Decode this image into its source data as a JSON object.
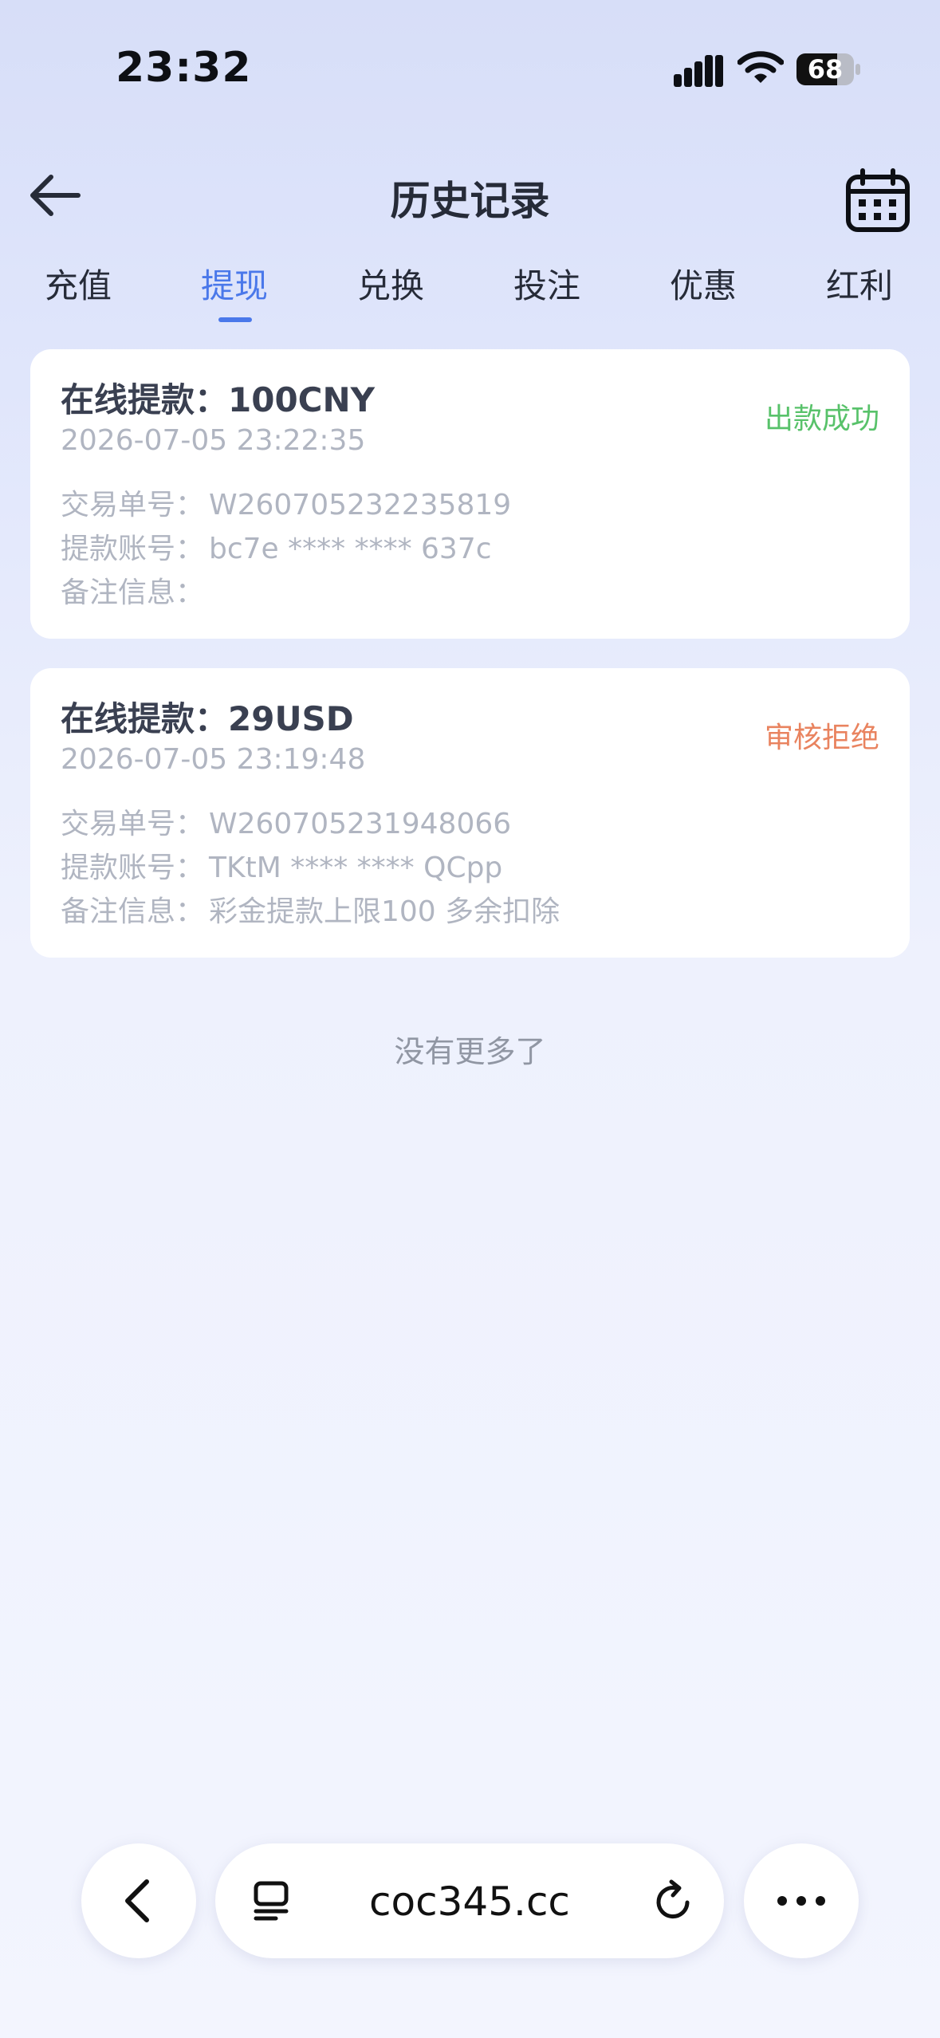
{
  "status_bar": {
    "time": "23:32",
    "battery": "68"
  },
  "header": {
    "title": "历史记录"
  },
  "tabs": [
    {
      "label": "充值"
    },
    {
      "label": "提现",
      "active": true
    },
    {
      "label": "兑换"
    },
    {
      "label": "投注"
    },
    {
      "label": "优惠"
    },
    {
      "label": "红利"
    }
  ],
  "records": [
    {
      "title": "在线提款：100CNY",
      "time": "2026-07-05 23:22:35",
      "status": "出款成功",
      "status_color": "#58c26a",
      "rows": [
        {
          "label": "交易单号：",
          "value": "W260705232235819"
        },
        {
          "label": "提款账号：",
          "value": "bc7e **** **** 637c"
        },
        {
          "label": "备注信息：",
          "value": ""
        }
      ]
    },
    {
      "title": "在线提款：29USD",
      "time": "2026-07-05 23:19:48",
      "status": "审核拒绝",
      "status_color": "#e9835f",
      "rows": [
        {
          "label": "交易单号：",
          "value": "W260705231948066"
        },
        {
          "label": "提款账号：",
          "value": "TKtM **** **** QCpp"
        },
        {
          "label": "备注信息：",
          "value": "彩金提款上限100 多余扣除"
        }
      ]
    }
  ],
  "list_end": "没有更多了",
  "browser": {
    "url": "coc345.cc"
  },
  "colors": {
    "accent": "#4a78ea"
  }
}
